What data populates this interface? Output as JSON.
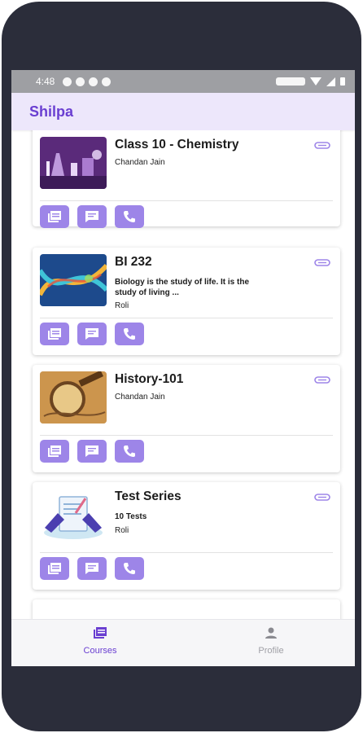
{
  "status_bar": {
    "time": "4:48"
  },
  "app_bar": {
    "title": "Shilpa"
  },
  "courses": [
    {
      "title": "Class 10 - Chemistry",
      "description": "",
      "teacher": "Chandan Jain",
      "thumbnail": "chemistry-lab-image"
    },
    {
      "title": "BI 232",
      "description": "Biology is the study of life. It is the study of living ...",
      "teacher": "Roli",
      "thumbnail": "dna-helix-image"
    },
    {
      "title": "History-101",
      "description": "",
      "teacher": "Chandan Jain",
      "thumbnail": "magnifier-map-image"
    },
    {
      "title": "Test Series",
      "description": "10 Tests",
      "teacher": "Roli",
      "thumbnail": "test-clipboard-illustration"
    }
  ],
  "card_actions": [
    "notes-icon",
    "chat-icon",
    "phone-icon"
  ],
  "bottom_nav": {
    "items": [
      {
        "label": "Courses",
        "icon": "courses-icon",
        "active": true
      },
      {
        "label": "Profile",
        "icon": "profile-icon",
        "active": false
      }
    ]
  },
  "colors": {
    "accent": "#6a3fd1",
    "button": "#9d85e8",
    "phone_frame": "#2b2d3a",
    "app_bar": "#ede7fb"
  }
}
